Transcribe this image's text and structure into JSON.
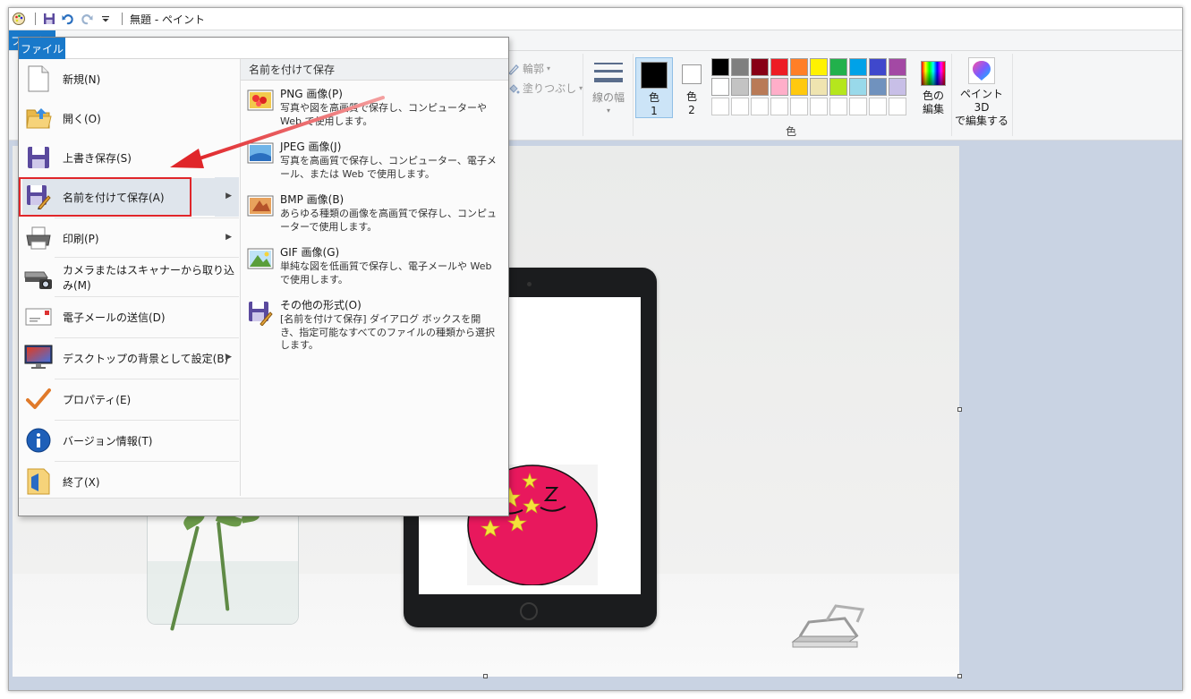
{
  "window": {
    "title": "無題 - ペイント"
  },
  "ribbon": {
    "file_tab": "ファイル",
    "outline_label": "輪郭",
    "fill_label": "塗りつぶし",
    "line_width_label": "線の幅",
    "color1_label": "色",
    "color1_num": "1",
    "color2_label": "色",
    "color2_num": "2",
    "color1_value": "#000000",
    "color2_value": "#ffffff",
    "palette": [
      "#000000",
      "#7f7f7f",
      "#880015",
      "#ed1c24",
      "#ff7f27",
      "#fff200",
      "#22b14c",
      "#00a2e8",
      "#3f48cc",
      "#a349a4",
      "#ffffff",
      "#c3c3c3",
      "#b97a57",
      "#ffaec9",
      "#ffc90e",
      "#efe4b0",
      "#b5e61d",
      "#99d9ea",
      "#7092be",
      "#c8bfe7",
      "#ffffff",
      "#ffffff",
      "#ffffff",
      "#ffffff",
      "#ffffff",
      "#ffffff",
      "#ffffff",
      "#ffffff",
      "#ffffff",
      "#ffffff"
    ],
    "edit_colors_label_1": "色の",
    "edit_colors_label_2": "編集",
    "colors_group_label": "色",
    "paint3d_label_1": "ペイント 3D",
    "paint3d_label_2": "で編集する"
  },
  "file_menu": {
    "tab": "ファイル",
    "items": [
      {
        "label": "新規(N)",
        "icon": "new-document-icon",
        "has_submenu": false
      },
      {
        "label": "開く(O)",
        "icon": "open-folder-icon",
        "has_submenu": false
      },
      {
        "label": "上書き保存(S)",
        "icon": "save-icon",
        "has_submenu": false
      },
      {
        "label": "名前を付けて保存(A)",
        "icon": "save-as-icon",
        "has_submenu": true
      },
      {
        "label": "印刷(P)",
        "icon": "printer-icon",
        "has_submenu": true
      },
      {
        "label": "カメラまたはスキャナーから取り込み(M)",
        "icon": "scanner-icon",
        "has_submenu": false
      },
      {
        "label": "電子メールの送信(D)",
        "icon": "email-icon",
        "has_submenu": false
      },
      {
        "label": "デスクトップの背景として設定(B)",
        "icon": "desktop-background-icon",
        "has_submenu": true
      },
      {
        "label": "プロパティ(E)",
        "icon": "checkmark-icon",
        "has_submenu": false
      },
      {
        "label": "バージョン情報(T)",
        "icon": "info-icon",
        "has_submenu": false
      },
      {
        "label": "終了(X)",
        "icon": "exit-icon",
        "has_submenu": false
      }
    ],
    "submenu": {
      "title": "名前を付けて保存",
      "items": [
        {
          "title": "PNG 画像(P)",
          "desc": "写真や図を高画質で保存し、コンピューターや Web で使用します。",
          "icon": "png-image-icon"
        },
        {
          "title": "JPEG 画像(J)",
          "desc": "写真を高画質で保存し、コンピューター、電子メール、または Web で使用します。",
          "icon": "jpeg-image-icon"
        },
        {
          "title": "BMP 画像(B)",
          "desc": "あらゆる種類の画像を高画質で保存し、コンピューターで使用します。",
          "icon": "bmp-image-icon"
        },
        {
          "title": "GIF 画像(G)",
          "desc": "単純な図を低画質で保存し、電子メールや Web で使用します。",
          "icon": "gif-image-icon"
        },
        {
          "title": "その他の形式(O)",
          "desc": "[名前を付けて保存] ダイアログ ボックスを開き、指定可能なすべてのファイルの種類から選択します。",
          "icon": "other-formats-icon"
        }
      ]
    }
  },
  "colors": {
    "accent": "#1979ca",
    "highlight_box": "#e0262a",
    "arrow": "#e0262a",
    "workspace_bg": "#c9d3e3"
  }
}
